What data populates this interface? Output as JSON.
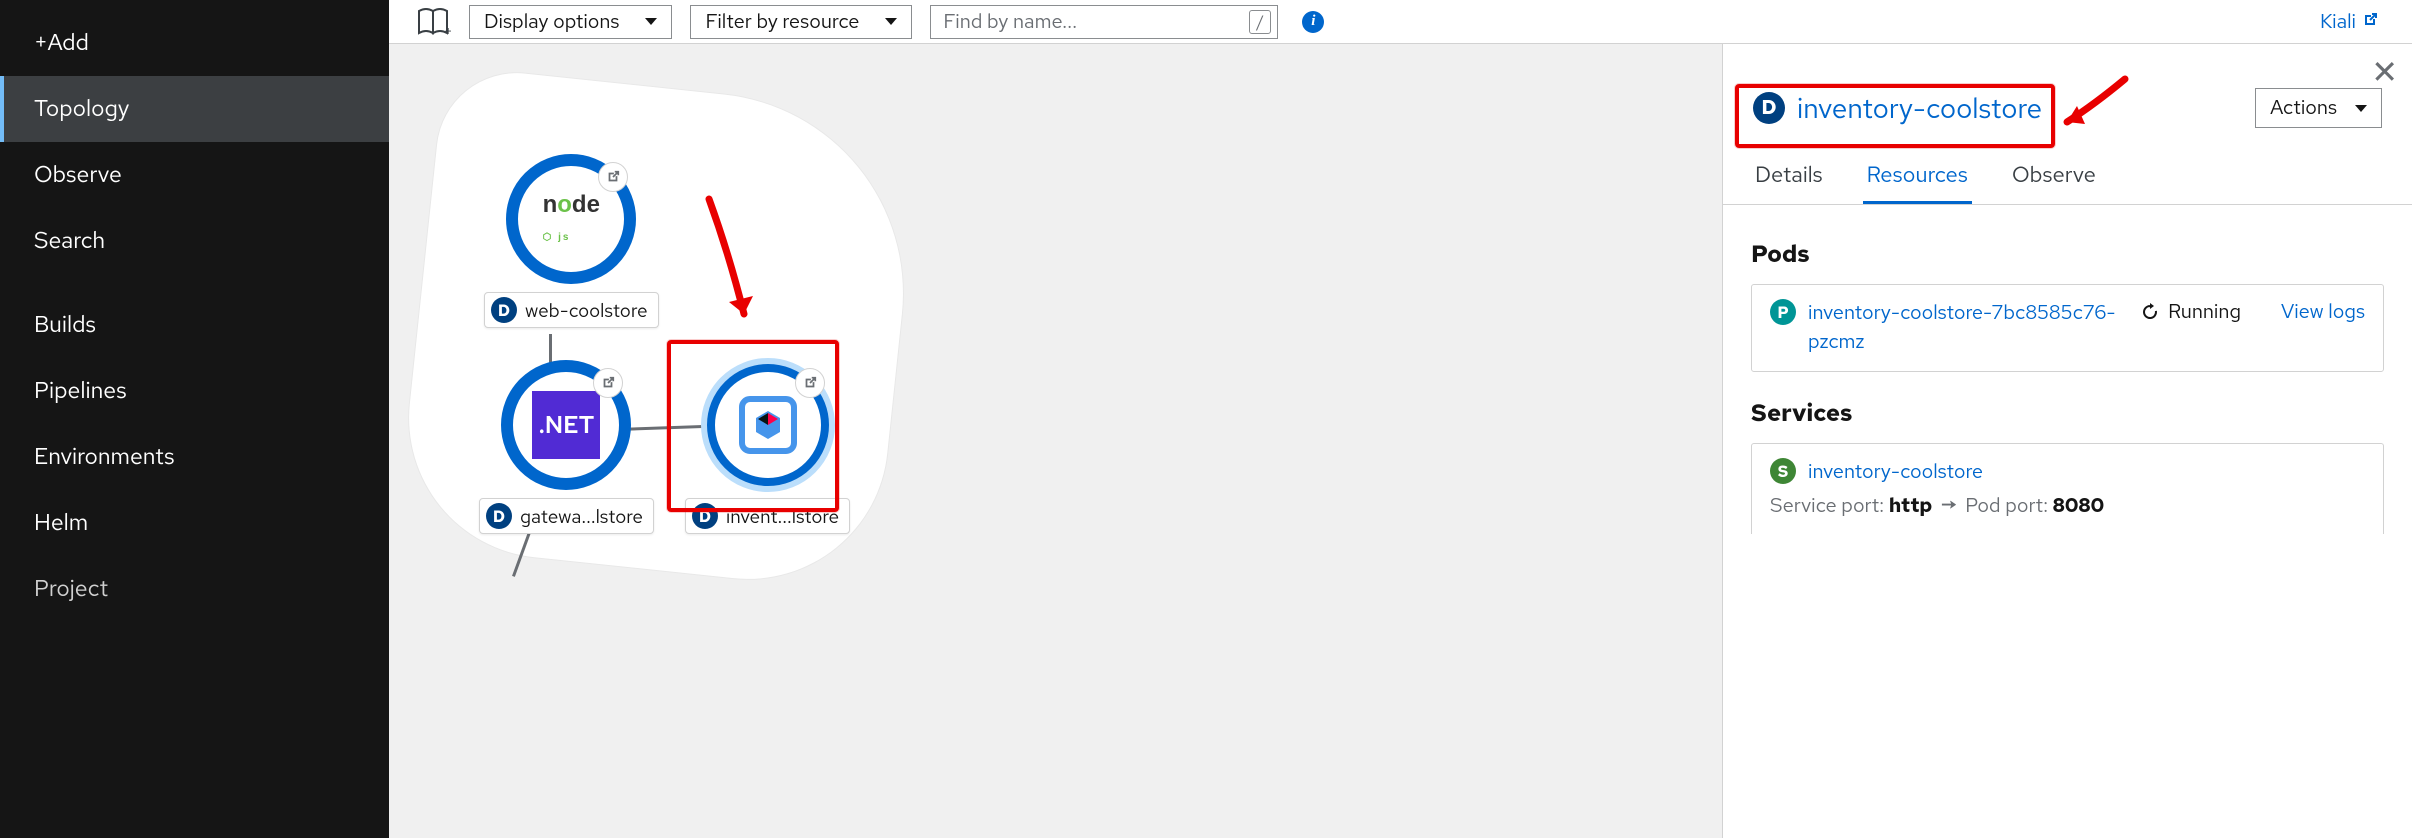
{
  "sidebar": {
    "items": [
      {
        "label": "+Add"
      },
      {
        "label": "Topology"
      },
      {
        "label": "Observe"
      },
      {
        "label": "Search"
      },
      {
        "label": "Builds"
      },
      {
        "label": "Pipelines"
      },
      {
        "label": "Environments"
      },
      {
        "label": "Helm"
      },
      {
        "label": "Project"
      }
    ]
  },
  "topbar": {
    "display_options": "Display options",
    "filter": "Filter by resource",
    "search_placeholder": "Find by name...",
    "slash": "/",
    "kiali": "Kiali"
  },
  "topology": {
    "nodes": {
      "web": {
        "label": "web-coolstore",
        "badge": "D"
      },
      "gateway": {
        "label": "gatewa...lstore",
        "badge": "D"
      },
      "inventory": {
        "label": "invent...lstore",
        "badge": "D"
      }
    }
  },
  "panel": {
    "title": "inventory-coolstore",
    "badge": "D",
    "actions_label": "Actions",
    "tabs": {
      "details": "Details",
      "resources": "Resources",
      "observe": "Observe"
    },
    "pods": {
      "heading": "Pods",
      "items": [
        {
          "name": "inventory-coolstore-7bc8585c76-pzcmz",
          "status": "Running",
          "log_link": "View logs"
        }
      ]
    },
    "services": {
      "heading": "Services",
      "items": [
        {
          "name": "inventory-coolstore",
          "port_label": "Service port:",
          "port_name": "http",
          "pod_port_label": "Pod port:",
          "pod_port": "8080"
        }
      ]
    }
  }
}
